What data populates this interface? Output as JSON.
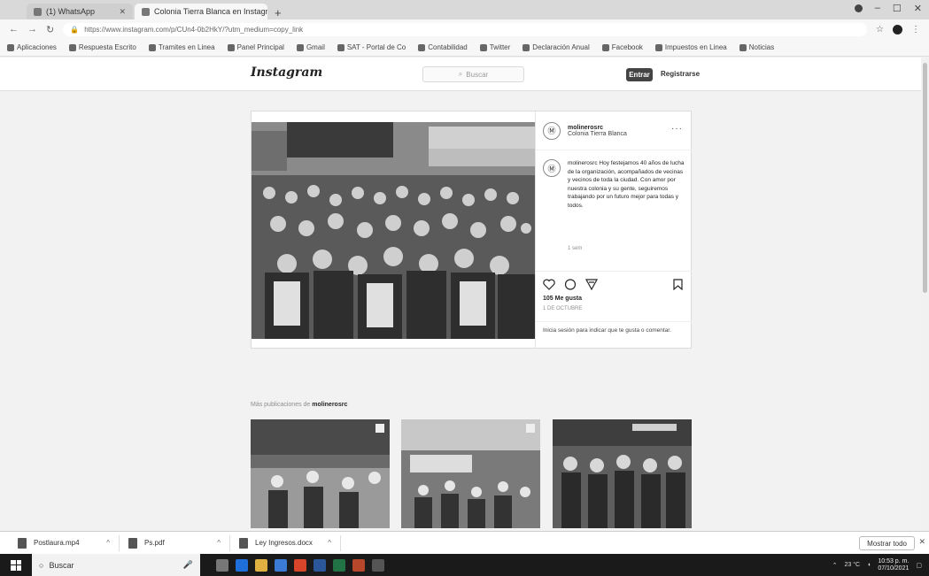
{
  "browser": {
    "tabs": [
      {
        "label": "(1) WhatsApp",
        "active": false
      },
      {
        "label": "Colonia Tierra Blanca en Instagram",
        "active": true
      }
    ],
    "new_tab": "+",
    "url": "https://www.instagram.com/p/CUn4-0b2HkY/?utm_medium=copy_link",
    "bookmarks": [
      "Aplicaciones",
      "Respuesta Escrito",
      "Tramites en Linea",
      "Panel Principal",
      "Gmail",
      "SAT - Portal de Co",
      "Contabilidad",
      "Twitter",
      "Declaración Anual",
      "Facebook",
      "Impuestos en Linea",
      "Noticias"
    ]
  },
  "instagram": {
    "logo": "Instagram",
    "search_placeholder": "Buscar",
    "login_label": "Entrar",
    "signup_label": "Registrarse",
    "post": {
      "username": "molinerosrc",
      "location": "Colonia Tierra Blanca",
      "caption": "molinerosrc Hoy festejamos 40 años de lucha de la organización, acompañados de vecinas y vecinos de toda la ciudad. Con amor por nuestra colonia y su gente, seguiremos trabajando por un futuro mejor para todas y todos.",
      "time": "1 sem",
      "likes": "105 Me gusta",
      "date": "1 DE OCTUBRE",
      "login_prompt": "Inicia sesión para indicar que te gusta o comentar."
    },
    "more_posts_prefix": "Más publicaciones de ",
    "more_posts_user": "molinerosrc"
  },
  "downloads": {
    "items": [
      "Postlaura.mp4",
      "Ps.pdf",
      "Ley Ingresos.docx"
    ],
    "show_all": "Mostrar todo"
  },
  "taskbar": {
    "search_placeholder": "Buscar",
    "weather": "23 °C",
    "time": "10:53 p. m.",
    "date": "07/10/2021"
  }
}
